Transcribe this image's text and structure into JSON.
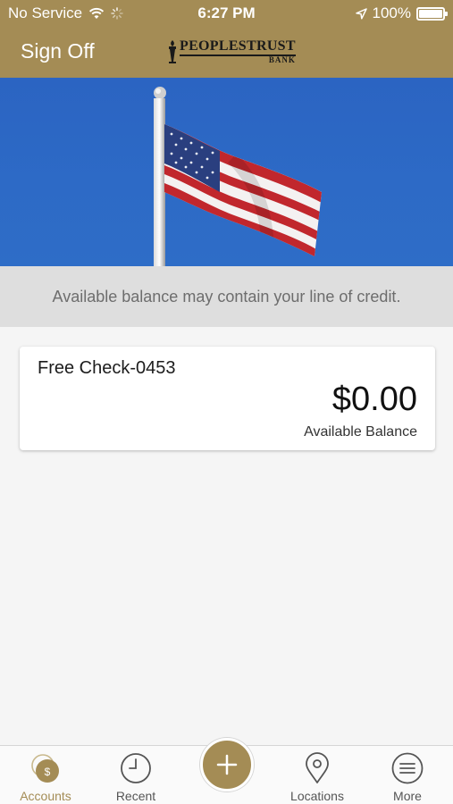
{
  "status_bar": {
    "carrier": "No Service",
    "time": "6:27 PM",
    "battery": "100%"
  },
  "header": {
    "sign_off_label": "Sign Off",
    "logo": {
      "main": "PEOPLESTRUST",
      "sub": "BANK"
    },
    "color": "#a48c55"
  },
  "notice": {
    "text": "Available balance may contain your line of credit."
  },
  "accounts": [
    {
      "name": "Free Check-0453",
      "balance": "$0.00",
      "balance_label": "Available Balance"
    }
  ],
  "tabbar": {
    "tabs": [
      {
        "label": "Accounts",
        "icon": "accounts-dollar-icon",
        "active": true
      },
      {
        "label": "Recent",
        "icon": "clock-icon",
        "active": false
      },
      {
        "label": "",
        "icon": "plus-icon",
        "active": false
      },
      {
        "label": "Locations",
        "icon": "map-pin-icon",
        "active": false
      },
      {
        "label": "More",
        "icon": "menu-icon",
        "active": false
      }
    ],
    "accent_color": "#a48c55"
  }
}
